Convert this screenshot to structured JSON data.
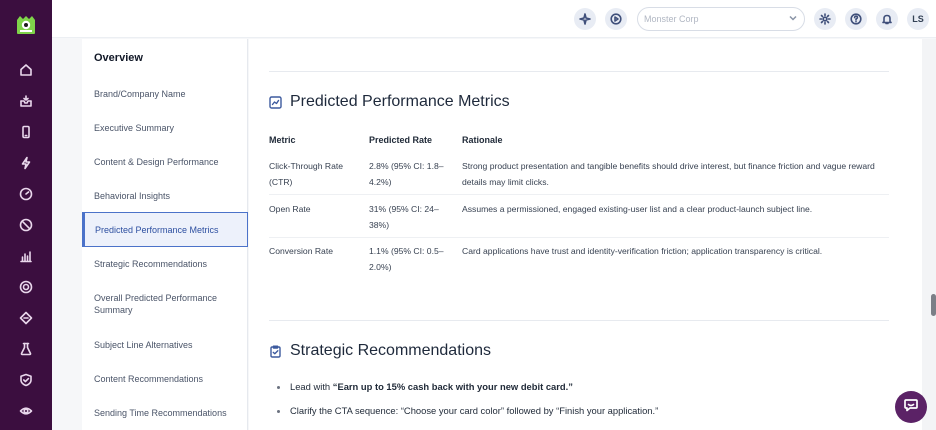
{
  "colors": {
    "rail": "#3b0e3f",
    "accent": "#4b72c9",
    "chat": "#5b2266"
  },
  "rail_icons": [
    "home-icon",
    "inbox-icon",
    "mobile-icon",
    "lightning-icon",
    "gauge-icon",
    "block-icon",
    "bar-chart-icon",
    "target-icon",
    "diamond-icon",
    "flask-icon",
    "shield-icon",
    "eye-icon"
  ],
  "topbar": {
    "org_placeholder": "Monster Corp",
    "avatar_initials": "LS"
  },
  "outline": {
    "title": "Overview",
    "items": [
      "Brand/Company Name",
      "Executive Summary",
      "Content & Design Performance",
      "Behavioral Insights",
      "Predicted Performance Metrics",
      "Strategic Recommendations",
      "Overall Predicted Performance Summary",
      "Subject Line Alternatives",
      "Content Recommendations",
      "Sending Time Recommendations"
    ],
    "active_index": 4
  },
  "metrics": {
    "title": "Predicted Performance Metrics",
    "headers": [
      "Metric",
      "Predicted Rate",
      "Rationale"
    ],
    "rows": [
      {
        "metric_l1": "Click-Through Rate",
        "metric_l2": "(CTR)",
        "rate_l1": "2.8% (95% CI: 1.8–",
        "rate_l2": "4.2%)",
        "rationale_l1": "Strong product presentation and tangible benefits should drive interest, but finance friction and vague reward",
        "rationale_l2": "details may limit clicks."
      },
      {
        "metric_l1": "Open Rate",
        "metric_l2": "",
        "rate_l1": "31% (95% CI: 24–",
        "rate_l2": "38%)",
        "rationale_l1": "Assumes a permissioned, engaged existing-user list and a clear product-launch subject line.",
        "rationale_l2": ""
      },
      {
        "metric_l1": "Conversion Rate",
        "metric_l2": "",
        "rate_l1": "1.1% (95% CI: 0.5–",
        "rate_l2": "2.0%)",
        "rationale_l1": "Card applications have trust and identity-verification friction; application transparency is critical.",
        "rationale_l2": ""
      }
    ]
  },
  "strategic": {
    "title": "Strategic Recommendations",
    "b1_prefix": "Lead with ",
    "b1_bold": "“Earn up to 15% cash back with your new debit card.”",
    "b2": "Clarify the CTA sequence: “Choose your card color” followed by “Finish your application.”"
  }
}
